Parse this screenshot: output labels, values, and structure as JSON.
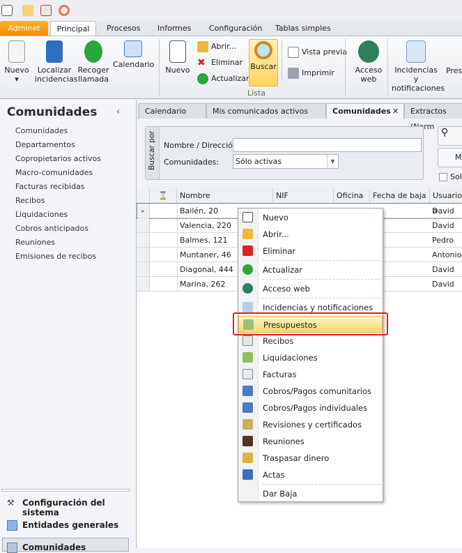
{
  "ribbon_tabs": [
    "Adminet",
    "Principal",
    "Procesos",
    "Informes",
    "Configuración",
    "Tablas simples"
  ],
  "ribbon": {
    "nuevo": "Nuevo",
    "localizar": "Localizar incidencias",
    "recoger": "Recoger llamada",
    "calendario": "Calendario",
    "nuevo2": "Nuevo",
    "abrir": "Abrir...",
    "eliminar": "Eliminar",
    "actualizar": "Actualizar",
    "buscar": "Buscar",
    "vista_previa": "Vista previa",
    "imprimir": "Imprimir",
    "group_lista": "Lista",
    "acceso_web": "Acceso web",
    "incidencias": "Incidencias y notificaciones",
    "presupuestos": "Pres"
  },
  "sidebar": {
    "title": "Comunidades",
    "items": [
      "Comunidades",
      "Departamentos",
      "Copropietarios activos",
      "Macro-comunidades",
      "Facturas recibidas",
      "Recibos",
      "Liquidaciones",
      "Cobros anticipados",
      "Reuniones",
      "Emisiones de recibos"
    ],
    "nav": [
      "Configuración del sistema",
      "Entidades generales",
      "Comunidades"
    ]
  },
  "doc_tabs": [
    "Calendario",
    "Mis comunicados activos",
    "Comunidades",
    "Extractos (Norm"
  ],
  "search": {
    "group": "Buscar por",
    "nombre_label": "Nombre / Dirección:",
    "nombre_value": "",
    "comunidades_label": "Comunidades:",
    "comunidades_value": "Sólo activas",
    "btn2": "M",
    "checkbox": "Soli"
  },
  "grid": {
    "columns": [
      "Nombre",
      "NIF",
      "Oficina",
      "Fecha de baja",
      "Usuario a"
    ],
    "rows": [
      {
        "nombre": "Bailén, 20",
        "usuario": "David"
      },
      {
        "nombre": "Valencia, 220",
        "usuario": "David"
      },
      {
        "nombre": "Balmes, 121",
        "usuario": "Pedro"
      },
      {
        "nombre": "Muntaner, 46",
        "usuario": "Antonio"
      },
      {
        "nombre": "Diagonal, 444",
        "usuario": "David"
      },
      {
        "nombre": "Marina, 262",
        "usuario": "David"
      }
    ]
  },
  "menu": [
    "Nuevo",
    "Abrir...",
    "Eliminar",
    "Actualizar",
    "Acceso web",
    "Incidencias y notificaciones",
    "Presupuestos",
    "Recibos",
    "Liquidaciones",
    "Facturas",
    "Cobros/Pagos comunitarios",
    "Cobros/Pagos individuales",
    "Revisiones y certificados",
    "Reuniones",
    "Traspasar dinero",
    "Actas",
    "Dar Baja"
  ]
}
